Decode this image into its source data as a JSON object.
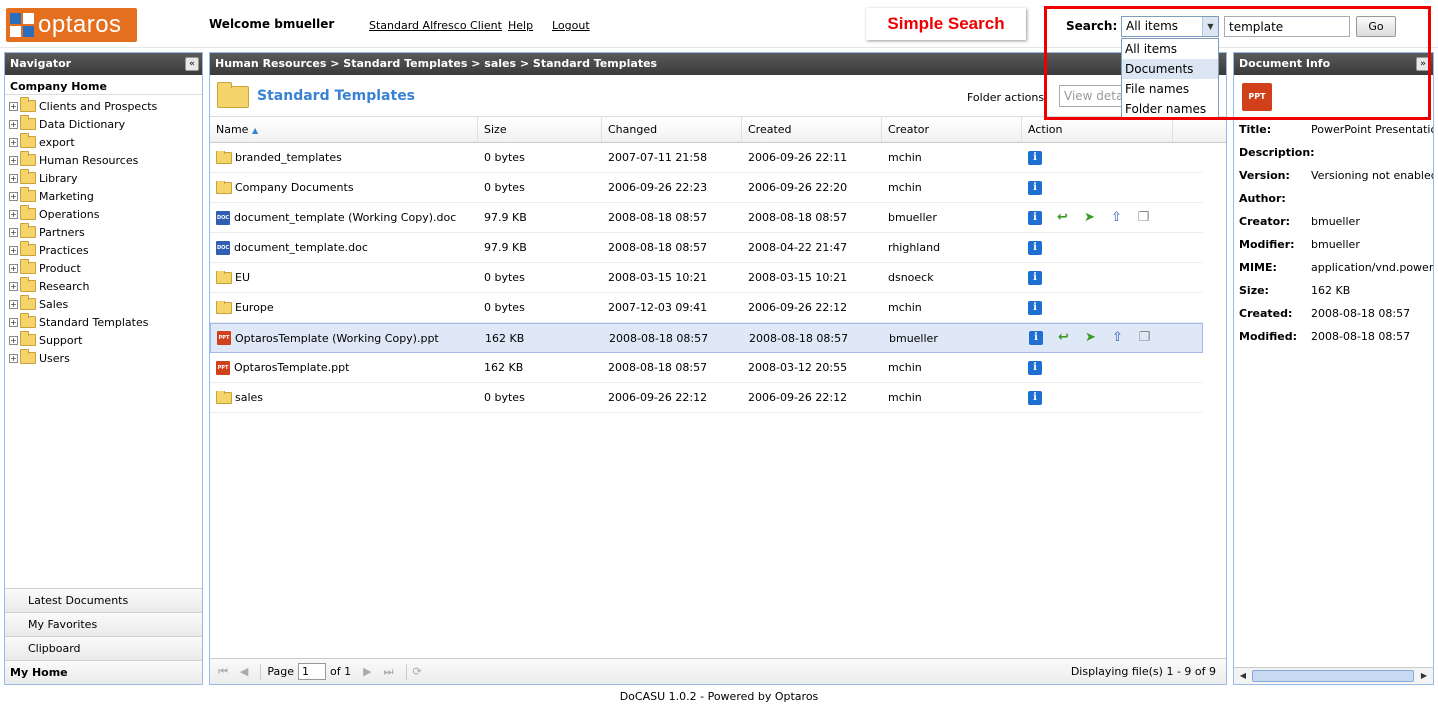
{
  "header": {
    "logo_text": "optaros",
    "welcome": "Welcome bmueller",
    "links": [
      "Standard Alfresco Client",
      "Help",
      "Logout"
    ],
    "callout": "Simple Search",
    "search_label": "Search:",
    "search_scope": "All items",
    "search_query": "template",
    "go_label": "Go",
    "scope_options": [
      "All items",
      "Documents",
      "File names",
      "Folder names"
    ],
    "highlighted_option": "Documents"
  },
  "navigator": {
    "title": "Navigator",
    "root": "Company Home",
    "items": [
      "Clients and Prospects",
      "Data Dictionary",
      "export",
      "Human Resources",
      "Library",
      "Marketing",
      "Operations",
      "Partners",
      "Practices",
      "Product",
      "Research",
      "Sales",
      "Standard Templates",
      "Support",
      "Users"
    ],
    "bottom": [
      "Latest Documents",
      "My Favorites",
      "Clipboard",
      "My Home"
    ]
  },
  "main": {
    "breadcrumb": "Human Resources > Standard Templates > sales > Standard Templates",
    "folder_title": "Standard Templates",
    "folder_actions_label": "Folder actions:",
    "folder_actions_value": "View deta",
    "columns": [
      "Name",
      "Size",
      "Changed",
      "Created",
      "Creator",
      "Action"
    ],
    "rows": [
      {
        "type": "folder",
        "name": "branded_templates",
        "size": "0 bytes",
        "changed": "2007-07-11 21:58",
        "created": "2006-09-26 22:11",
        "creator": "mchin",
        "actions": "info"
      },
      {
        "type": "folder",
        "name": "Company Documents",
        "size": "0 bytes",
        "changed": "2006-09-26 22:23",
        "created": "2006-09-26 22:20",
        "creator": "mchin",
        "actions": "info"
      },
      {
        "type": "doc",
        "name": "document_template (Working Copy).doc",
        "size": "97.9 KB",
        "changed": "2008-08-18 08:57",
        "created": "2008-08-18 08:57",
        "creator": "bmueller",
        "actions": "full"
      },
      {
        "type": "doc",
        "name": "document_template.doc",
        "size": "97.9 KB",
        "changed": "2008-08-18 08:57",
        "created": "2008-04-22 21:47",
        "creator": "rhighland",
        "actions": "info"
      },
      {
        "type": "folder",
        "name": "EU",
        "size": "0 bytes",
        "changed": "2008-03-15 10:21",
        "created": "2008-03-15 10:21",
        "creator": "dsnoeck",
        "actions": "info"
      },
      {
        "type": "folder",
        "name": "Europe",
        "size": "0 bytes",
        "changed": "2007-12-03 09:41",
        "created": "2006-09-26 22:12",
        "creator": "mchin",
        "actions": "info"
      },
      {
        "type": "ppt",
        "name": "OptarosTemplate (Working Copy).ppt",
        "size": "162 KB",
        "changed": "2008-08-18 08:57",
        "created": "2008-08-18 08:57",
        "creator": "bmueller",
        "actions": "full",
        "selected": true
      },
      {
        "type": "ppt",
        "name": "OptarosTemplate.ppt",
        "size": "162 KB",
        "changed": "2008-08-18 08:57",
        "created": "2008-03-12 20:55",
        "creator": "mchin",
        "actions": "info"
      },
      {
        "type": "folder",
        "name": "sales",
        "size": "0 bytes",
        "changed": "2006-09-26 22:12",
        "created": "2006-09-26 22:12",
        "creator": "mchin",
        "actions": "info"
      }
    ],
    "pager": {
      "page_label": "Page",
      "page": "1",
      "of_label": "of 1",
      "display": "Displaying file(s) 1 - 9 of 9"
    }
  },
  "doc_info": {
    "title": "Document Info",
    "icon_label": "PPT",
    "fields": [
      {
        "key": "Title:",
        "value": "PowerPoint Presentation"
      },
      {
        "key": "Description:",
        "value": ""
      },
      {
        "key": "Version:",
        "value": "Versioning not enabled"
      },
      {
        "key": "Author:",
        "value": ""
      },
      {
        "key": "Creator:",
        "value": "bmueller"
      },
      {
        "key": "Modifier:",
        "value": "bmueller"
      },
      {
        "key": "MIME:",
        "value": "application/vnd.powerpoint"
      },
      {
        "key": "Size:",
        "value": "162 KB"
      },
      {
        "key": "Created:",
        "value": "2008-08-18 08:57"
      },
      {
        "key": "Modified:",
        "value": "2008-08-18 08:57"
      }
    ]
  },
  "footer": "DoCASU 1.0.2 - Powered by Optaros",
  "icons": {
    "info": "info-icon",
    "checkin": "checkin-icon",
    "cancel": "cancel-checkout-icon",
    "update": "update-icon",
    "copy": "copy-icon"
  },
  "colors": {
    "accent": "#3a82d4",
    "logo": "#e36f1f",
    "highlight": "#e00000",
    "selected_row": "#dfe8f6"
  }
}
